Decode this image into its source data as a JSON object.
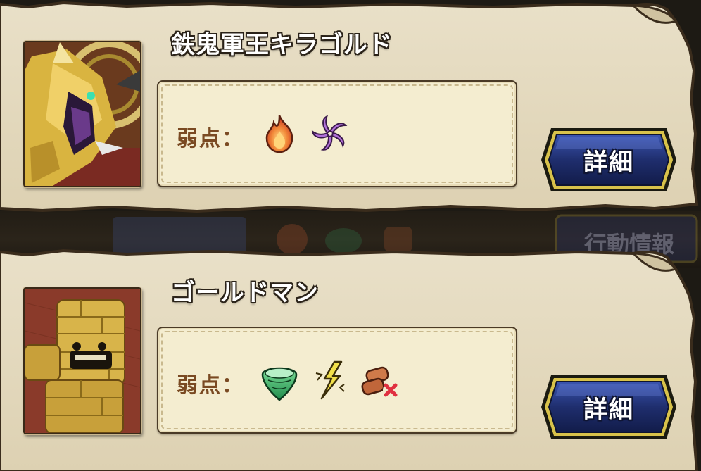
{
  "monsters": [
    {
      "name": "鉄鬼軍王キラゴルド",
      "portrait": "golden-armored-dragon-portrait",
      "weakness_label": "弱点：",
      "weaknesses": [
        "fire-icon",
        "dark-swirl-icon"
      ],
      "detail_label": "詳細"
    },
    {
      "name": "ゴールドマン",
      "portrait": "gold-golem-portrait",
      "weakness_label": "弱点：",
      "weaknesses": [
        "wind-icon",
        "lightning-icon",
        "debuff-icon"
      ],
      "detail_label": "詳細"
    }
  ],
  "background_partial": {
    "button_label": "行動情報"
  },
  "colors": {
    "parchment": "#e6dcc2",
    "weak_box": "#f4edd0",
    "weak_label": "#7a4a22",
    "button_fill": "#1f2e6e",
    "button_border": "#d8c24a"
  }
}
